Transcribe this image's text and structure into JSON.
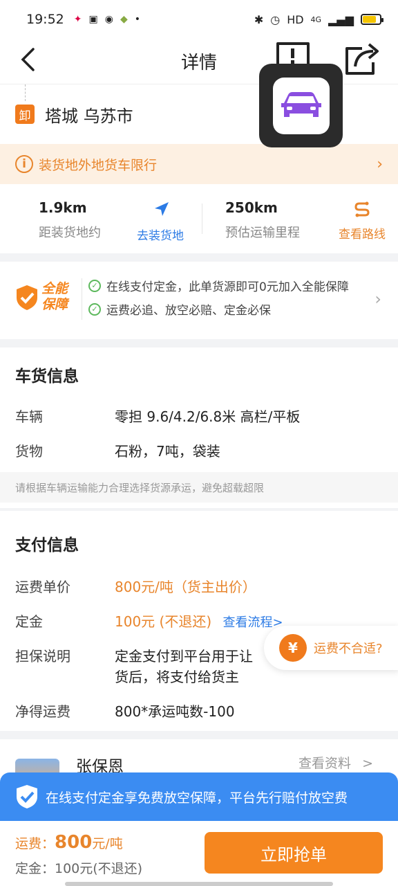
{
  "status_bar": {
    "time": "19:52",
    "network": "HD",
    "signal": "4G"
  },
  "nav": {
    "title": "详情"
  },
  "unload": {
    "badge": "卸",
    "location": "塔城 乌苏市"
  },
  "notice": {
    "icon": "i",
    "text": "装货地外地货车限行"
  },
  "distance": {
    "to_loading_value": "1.9km",
    "to_loading_label": "距装货地约",
    "go_loading_link": "去装货地",
    "route_value": "250km",
    "route_label": "预估运输里程",
    "view_route_link": "查看路线"
  },
  "guarantee": {
    "badge_line1": "全能",
    "badge_line2": "保障",
    "line1": "在线支付定金，此单货源即可0元加入全能保障",
    "line2": "运费必追、放空必赔、定金必保"
  },
  "cargo": {
    "title": "车货信息",
    "vehicle_label": "车辆",
    "vehicle_value": "零担 9.6/4.2/6.8米 高栏/平板",
    "goods_label": "货物",
    "goods_value": "石粉，7吨，袋装",
    "tip": "请根据车辆运输能力合理选择货源承运，避免超载超限"
  },
  "payment": {
    "title": "支付信息",
    "unit_price_label": "运费单价",
    "unit_price_value": "800元/吨（货主出价）",
    "deposit_label": "定金",
    "deposit_value": "100元 (不退还)",
    "deposit_link": "查看流程>",
    "guarantee_label": "担保说明",
    "guarantee_line1": "定金支付到平台用于让",
    "guarantee_line2": "货后，将支付给货主",
    "net_label": "净得运费",
    "net_value": "800*承运吨数-100"
  },
  "fee_bubble": {
    "icon": "¥",
    "text": "运费不合适?"
  },
  "shipper": {
    "name": "张保恩",
    "view_profile": "查看资料",
    "arrow": ">"
  },
  "banner": {
    "text": "在线支付定金享免费放空保障，平台先行赔付放空费"
  },
  "bottom": {
    "price_prefix": "运费：",
    "price_value": "800",
    "price_unit": "元/吨",
    "deposit_text": "定金：100元(不退还)",
    "grab_button": "立即抢单"
  },
  "colors": {
    "accent": "#f5861f",
    "link": "#2c7be5",
    "banner": "#3b8cf2"
  }
}
